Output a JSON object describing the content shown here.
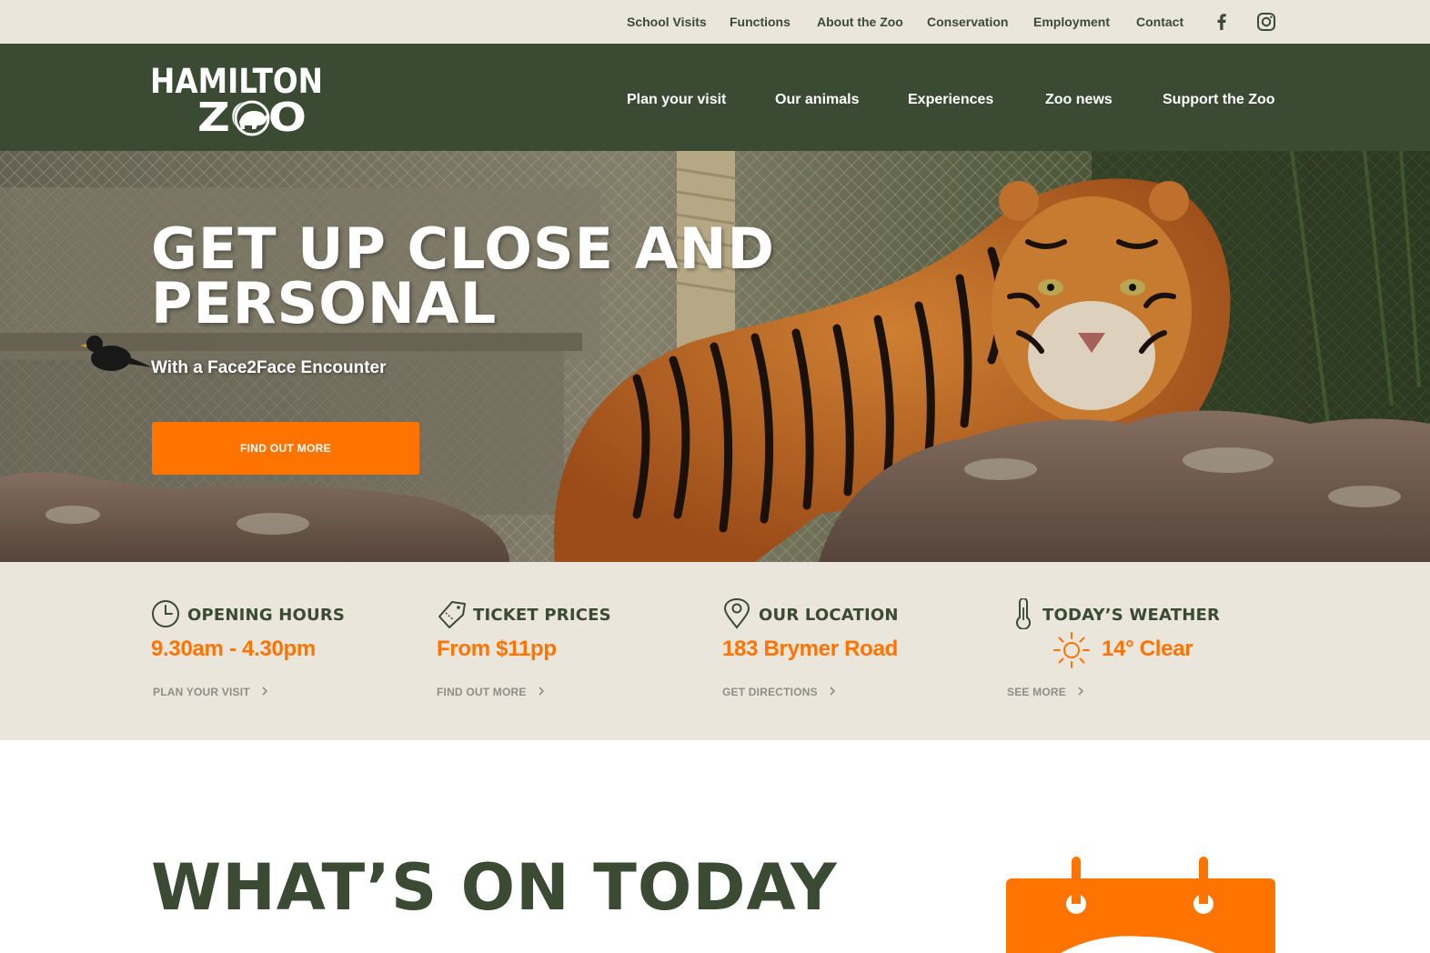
{
  "utility_nav": {
    "links": [
      "School Visits",
      "Functions",
      "About the Zoo",
      "Conservation",
      "Employment",
      "Contact"
    ],
    "social": [
      "facebook-icon",
      "instagram-icon"
    ]
  },
  "brand": {
    "logo_line1": "HAMILTON",
    "logo_line2": "ZOO"
  },
  "main_nav": {
    "links": [
      "Plan your visit",
      "Our animals",
      "Experiences",
      "Zoo news",
      "Support the Zoo"
    ]
  },
  "hero": {
    "title": "Get up close and personal",
    "subtitle": "With a Face2Face Encounter",
    "button": "FIND OUT MORE"
  },
  "info": {
    "hours": {
      "icon": "clock-icon",
      "heading": "Opening hours",
      "value": "9.30am - 4.30pm",
      "link": "Plan your visit"
    },
    "tickets": {
      "icon": "ticket-icon",
      "heading": "Ticket prices",
      "value": "From $11pp",
      "link": "Find out more"
    },
    "location": {
      "icon": "map-pin-icon",
      "heading": "Our location",
      "value": "183 Brymer Road",
      "link": "Get directions"
    },
    "weather": {
      "icon": "thermometer-icon",
      "heading": "Today’s weather",
      "value": "14° Clear",
      "weather_icon": "sun-icon",
      "link": "See more"
    }
  },
  "whats_on": {
    "heading": "What’s on today",
    "icon": "calendar-icon"
  },
  "colors": {
    "dark_green": "#3a4a33",
    "orange": "#ff7300",
    "beige": "#ebe6dc",
    "grey_link": "#8e8e86"
  }
}
